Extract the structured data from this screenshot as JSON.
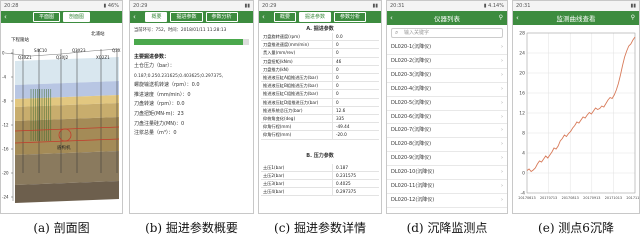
{
  "panel_a": {
    "status_time": "20:28",
    "status_right": "▮ 46%",
    "back_symbol": "‹",
    "tabs": [
      "平面图",
      "剖面图"
    ],
    "active_tab": 1,
    "station_left": "下程陵站",
    "station_right": "北浦站",
    "borehole_labels": [
      "Q3XZ1",
      "S4C10",
      "Q3XJ2",
      "Q3X23",
      "XQ2Z1",
      "Q3X"
    ],
    "depth_ticks": [
      "0",
      "-4",
      "-8",
      "-12",
      "-16",
      "-20",
      "-24"
    ],
    "shield_label": "盾构机",
    "layer_colors": [
      "#d9e7ef",
      "#b8c6e3",
      "#e2c780",
      "#c8ad6d",
      "#a48b57",
      "#8a7a5e",
      "#6d5f4d"
    ],
    "caption": "(a) 剖面图"
  },
  "panel_b": {
    "status_time": "20:29",
    "tabs": [
      "概要",
      "掘进参数",
      "参数分析"
    ],
    "active_tab": 0,
    "ring_info": "当前环号：752，时间：2018/01/11 11:28:13",
    "progress_fraction": 0.95,
    "section_title": "主要掘进参数：",
    "rows": [
      "土仓压力（bar）：",
      "0.187;0.250.231625;0.403625;0.297375,",
      "螺旋输送机转速（rpm）：0.0",
      "推进速度（mm/min）：0",
      "刀盘转速（rpm）：0.0",
      "刀盘扭矩(MN·m)：23",
      "刀盘注量硅力(MN)：0",
      "注浆总量（m³）：0"
    ],
    "caption": "(b) 掘进参数概要"
  },
  "panel_c": {
    "status_time": "20:29",
    "tabs": [
      "概要",
      "掘进参数",
      "参数分析"
    ],
    "active_tab": 1,
    "section_a": "A. 掘进参数",
    "rows_a": [
      [
        "刀盘旋转速度(rpm)",
        "0.0"
      ],
      [
        "刀盘推进速度(mm/min)",
        "0"
      ],
      [
        "贯入量(mm/rev)",
        "0"
      ],
      [
        "刀盘扭矩(kNm)",
        "46"
      ],
      [
        "刀盘推力(kN)",
        "0"
      ],
      [
        "推进液压缸A组推进压力(bar)",
        "0"
      ],
      [
        "推进液压缸B组推进压力(bar)",
        "0"
      ],
      [
        "推进液压缸C组推进压力(bar)",
        "0"
      ],
      [
        "推进液压缸D组推进压力(bar)",
        "0"
      ],
      [
        "推进系统总压力(bar)",
        "12.6"
      ],
      [
        "仰俯角变化(deg)",
        "335"
      ],
      [
        "仰角行程(mm)",
        "-49.44"
      ],
      [
        "仰角行程(mm)",
        "-20.0"
      ]
    ],
    "section_b": "B. 压力参数",
    "rows_b": [
      [
        "土压1(bar)",
        "0.187"
      ],
      [
        "土压2(bar)",
        "0.231575"
      ],
      [
        "土压3(bar)",
        "0.4025"
      ],
      [
        "土压4(bar)",
        "0.297375"
      ]
    ],
    "caption": "(c) 掘进参数详情"
  },
  "panel_d": {
    "status_time": "20:31",
    "status_right": "▮ 4.14% ",
    "title": "仪器列表",
    "search_placeholder": "输入关键字",
    "items": [
      "DL020-1(沉降仪)",
      "DL020-2(沉降仪)",
      "DL020-3(沉降仪)",
      "DL020-4(沉降仪)",
      "DL020-5(沉降仪)",
      "DL020-6(沉降仪)",
      "DL020-7(沉降仪)",
      "DL020-8(沉降仪)",
      "DL020-9(沉降仪)",
      "DL020-10(沉降仪)",
      "DL020-11(沉降仪)",
      "DL020-12(沉降仪)"
    ],
    "caption": "(d) 沉降监测点"
  },
  "panel_e": {
    "status_time": "20:31",
    "title": "监测曲线查看",
    "chart_data": {
      "type": "line",
      "y_ticks": [
        "28",
        "24",
        "20",
        "16",
        "12",
        "8",
        "4",
        "0",
        "-4"
      ],
      "ylim": [
        -4,
        28
      ],
      "series": [
        {
          "values": [
            0.5,
            0.8,
            0.3,
            0.6,
            1.0,
            1.8,
            2.4,
            2.2,
            2.8,
            3.4,
            3.0,
            3.6,
            4.2,
            5.0,
            4.8,
            5.4,
            6.4,
            6.9,
            7.6,
            7.3,
            7.9,
            8.3,
            9.0,
            9.5,
            10.2,
            10.0,
            10.6,
            11.2,
            11.0,
            11.6,
            12.1,
            11.8,
            12.4,
            13.0,
            12.7,
            12.9,
            13.4,
            13.2,
            13.9,
            14.6,
            15.1,
            14.9,
            15.6,
            16.6,
            17.9,
            19.6,
            21.5,
            23.2,
            24.4,
            25.4,
            25.8,
            26.6,
            27.2
          ]
        }
      ],
      "x_ticks": [
        "20170613",
        "20170713",
        "20170813",
        "20170913",
        "20171013",
        "20171114"
      ],
      "line_color": "#d87b5a"
    },
    "caption": "(e) 测点6沉降"
  }
}
